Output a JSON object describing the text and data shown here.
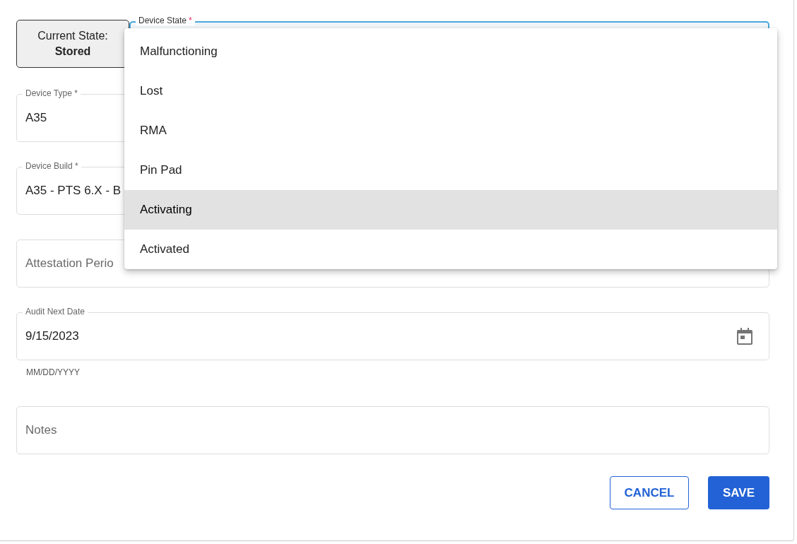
{
  "current_state": {
    "label": "Current State:",
    "value": "Stored"
  },
  "device_state": {
    "label": "Device State",
    "required_mark": "*",
    "focused": true
  },
  "menu": [
    {
      "label": "Malfunctioning",
      "selected": false
    },
    {
      "label": "Lost",
      "selected": false
    },
    {
      "label": "RMA",
      "selected": false
    },
    {
      "label": "Pin Pad",
      "selected": false
    },
    {
      "label": "Activating",
      "selected": true
    },
    {
      "label": "Activated",
      "selected": false
    }
  ],
  "fields": [
    {
      "kind": "filled",
      "label": "Device Type *",
      "value": "A35"
    },
    {
      "kind": "filled",
      "label": "Device Build *",
      "value": "A35 - PTS 6.X - B"
    },
    {
      "kind": "empty",
      "placeholder": "Attestation Perio"
    },
    {
      "kind": "date",
      "label": "Audit Next Date",
      "value": "9/15/2023",
      "helper": "MM/DD/YYYY"
    },
    {
      "kind": "empty",
      "placeholder": "Notes"
    }
  ],
  "buttons": [
    {
      "label": "CANCEL",
      "kind": "outlined"
    },
    {
      "label": "SAVE",
      "kind": "contained"
    }
  ]
}
